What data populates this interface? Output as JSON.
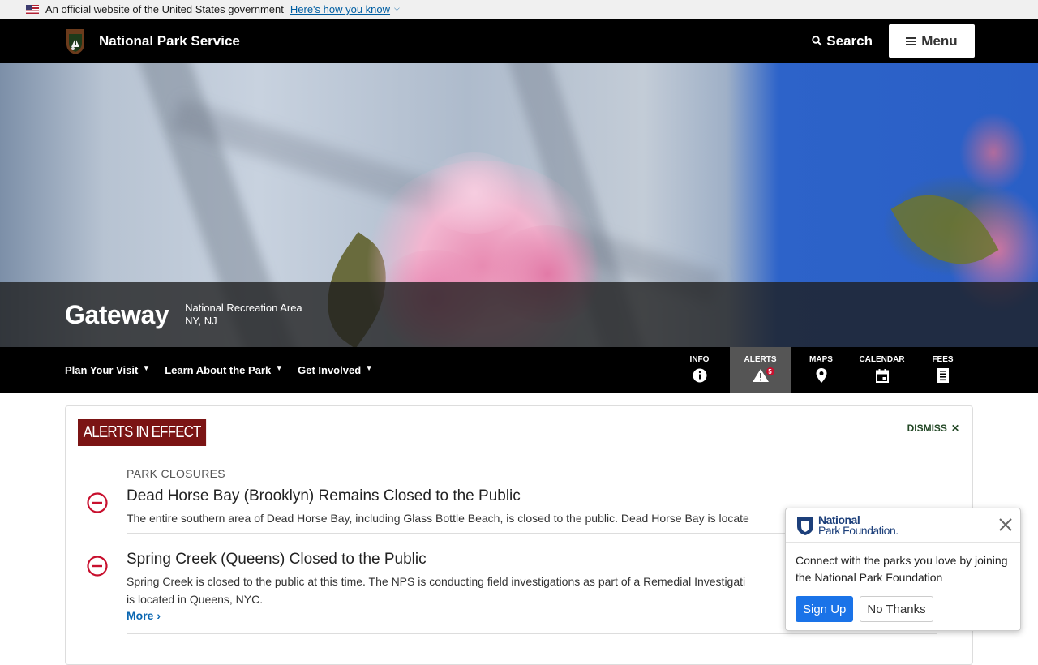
{
  "gov_banner": {
    "text": "An official website of the United States government",
    "link": "Here's how you know"
  },
  "header": {
    "title": "National Park Service",
    "search_label": "Search",
    "menu_label": "Menu"
  },
  "hero": {
    "park_name": "Gateway",
    "designation": "National Recreation Area",
    "states": "NY, NJ"
  },
  "park_nav": {
    "items": [
      "Plan Your Visit",
      "Learn About the Park",
      "Get Involved"
    ],
    "quick": {
      "info": "INFO",
      "alerts": "ALERTS",
      "alerts_count": "5",
      "maps": "MAPS",
      "calendar": "CALENDAR",
      "fees": "FEES"
    }
  },
  "alerts": {
    "title": "ALERTS IN EFFECT",
    "dismiss": "DISMISS",
    "category": "PARK CLOSURES",
    "items": [
      {
        "title": "Dead Horse Bay (Brooklyn) Remains Closed to the Public",
        "text": "The entire southern area of Dead Horse Bay, including Glass Bottle Beach, is closed to the public. Dead Horse Bay is locate"
      },
      {
        "title": "Spring Creek (Queens) Closed to the Public",
        "text": "Spring Creek is closed to the public at this time. The NPS is conducting field investigations as part of a Remedial Investigati",
        "text2": "is located in Queens, NYC.",
        "more": "More ›"
      }
    ]
  },
  "popup": {
    "logo_line1": "National",
    "logo_line2": "Park Foundation.",
    "body": "Connect with the parks you love by joining the National Park Foundation",
    "signup": "Sign Up",
    "no_thanks": "No Thanks"
  },
  "colors": {
    "alert_red": "#7b1414",
    "link_blue": "#0b67b2",
    "signup_blue": "#1a73e8"
  }
}
